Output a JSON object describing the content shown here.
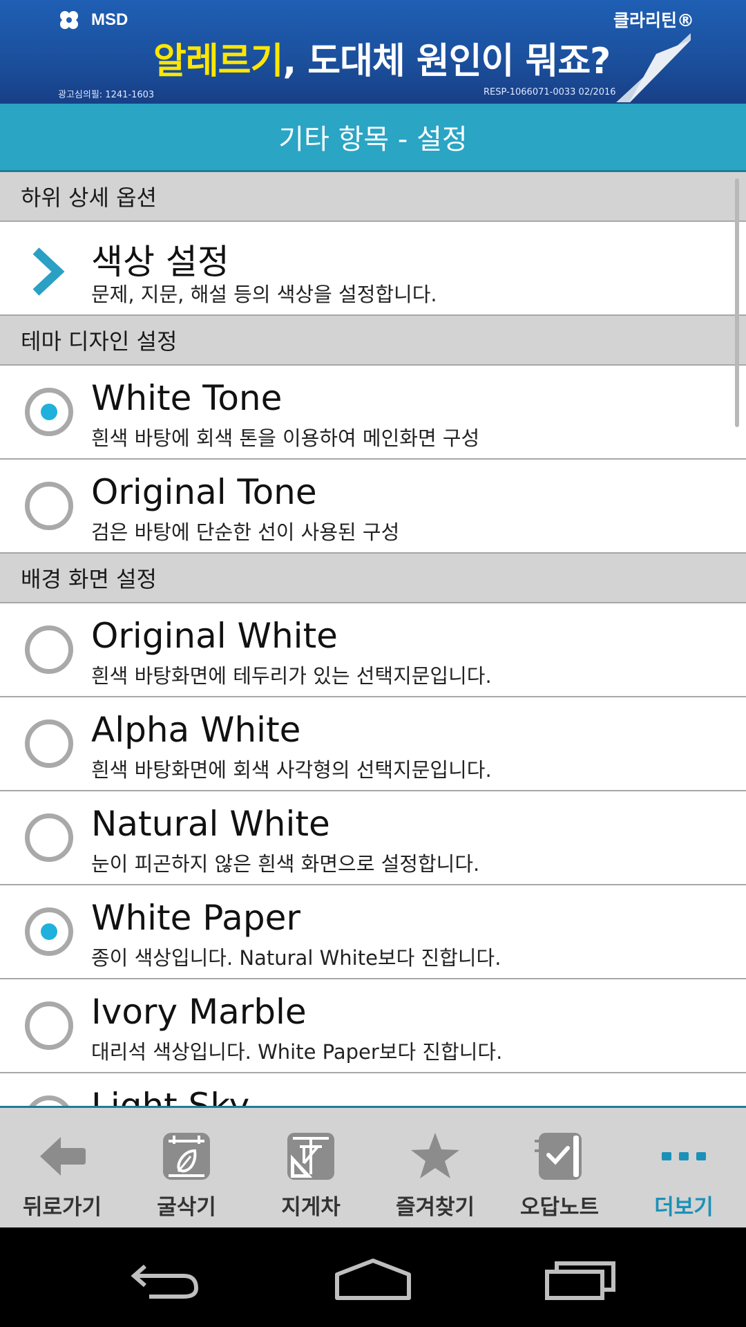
{
  "ad": {
    "logo_text": "MSD",
    "brand": "클라리틴®",
    "headline_highlight": "알레르기",
    "headline_rest": ", 도대체 원인이 뭐죠?",
    "small_left": "광고심의필: 1241-1603",
    "small_right": "RESP-1066071-0033 02/2016"
  },
  "header": {
    "title": "기타 항목 - 설정"
  },
  "sections": [
    {
      "title": "하위 상세 옵션"
    },
    {
      "title": "테마 디자인 설정"
    },
    {
      "title": "배경 화면 설정"
    }
  ],
  "color_setting": {
    "title": "색상 설정",
    "desc": "문제, 지문, 해설 등의 색상을 설정합니다.",
    "icon": "chevron-right-icon"
  },
  "themes": [
    {
      "title": "White Tone",
      "desc": "흰색 바탕에 회색 톤을 이용하여 메인화면 구성",
      "selected": true
    },
    {
      "title": "Original Tone",
      "desc": "검은 바탕에 단순한 선이 사용된 구성",
      "selected": false
    }
  ],
  "backgrounds": [
    {
      "title": "Original White",
      "desc": "흰색 바탕화면에 테두리가 있는 선택지문입니다.",
      "selected": false
    },
    {
      "title": "Alpha White",
      "desc": "흰색 바탕화면에 회색 사각형의 선택지문입니다.",
      "selected": false
    },
    {
      "title": "Natural White",
      "desc": "눈이 피곤하지 않은 흰색 화면으로 설정합니다.",
      "selected": false
    },
    {
      "title": "White Paper",
      "desc": "종이 색상입니다. Natural White보다 진합니다.",
      "selected": true
    },
    {
      "title": "Ivory Marble",
      "desc": "대리석 색상입니다. White Paper보다 진합니다.",
      "selected": false
    },
    {
      "title": "Light Sky",
      "desc": "",
      "selected": false
    }
  ],
  "toolbar": {
    "items": [
      {
        "label": "뒤로가기",
        "icon": "back-arrow-icon"
      },
      {
        "label": "굴삭기",
        "icon": "excavator-icon"
      },
      {
        "label": "지게차",
        "icon": "forklift-icon"
      },
      {
        "label": "즐겨찾기",
        "icon": "star-icon"
      },
      {
        "label": "오답노트",
        "icon": "wrong-answer-note-icon"
      },
      {
        "label": "더보기",
        "icon": "more-dots-icon"
      }
    ],
    "active_color": "#1b91b8"
  },
  "colors": {
    "accent": "#2aa5c4",
    "radio_selected": "#1fb1dc"
  }
}
